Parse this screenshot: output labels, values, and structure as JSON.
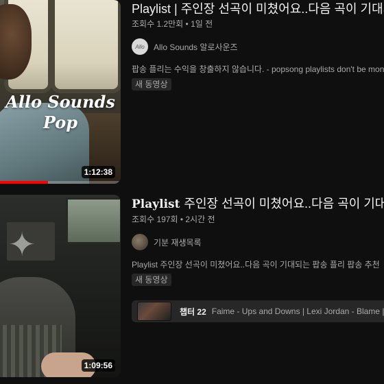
{
  "results": [
    {
      "title": "Playlist | 주인장 선곡이 미쳤어요..다음 곡이 기대되는 팝송 플리",
      "meta": "조회수 1.2만회 • 1일 전",
      "channel": "Allo Sounds 알로사운즈",
      "avatar_text": "Allo",
      "description": "팝송 플리는 수익을 창출하지 않습니다. - popsong playlists don't be monetized",
      "badge": "새 동영상",
      "duration": "1:12:38",
      "thumb_text_1": "Allo Sounds",
      "thumb_text_2": "Pop",
      "watch_progress": 0.4
    },
    {
      "title_lead": "Playlist",
      "title_rest": "주인장 선곡이 미쳤어요..다음 곡이 기대되는 팝송 플리",
      "meta": "조회수 197회 • 2시간 전",
      "channel": "기분 재생목록",
      "description": "Playlist 주인장 선곡이 미쳤어요..다음 곡이 기대되는 팝송 플리 팝송 추천",
      "badge": "새 동영상",
      "duration": "1:09:56",
      "chapter_label": "챕터 22",
      "chapter_text": "Faime - Ups and Downs | Lexi Jordan - Blame | Only Love"
    }
  ],
  "colors": {
    "background": "#0f0f0f",
    "progress": "#ff0000",
    "text": "#f1f1f1",
    "secondary": "#aaaaaa"
  }
}
